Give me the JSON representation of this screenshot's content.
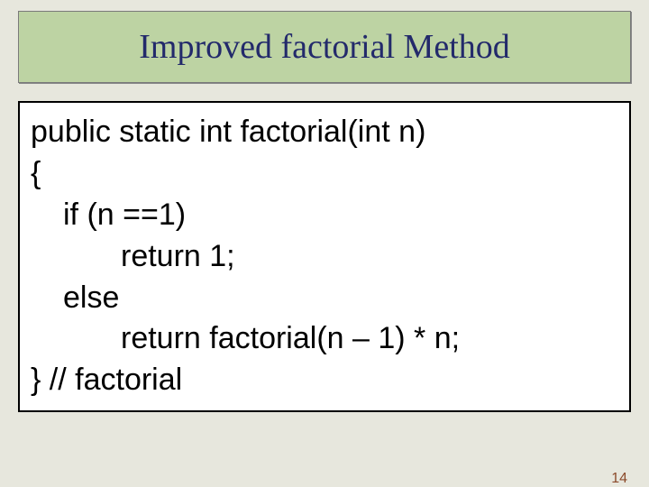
{
  "title": "Improved factorial Method",
  "code": {
    "l1": "public static int factorial(int n)",
    "l2": "{",
    "l3": "if (n ==1)",
    "l4": "return 1;",
    "l5": "else",
    "l6": "return factorial(n – 1) * n;",
    "l7": "} // factorial"
  },
  "page_number": "14"
}
